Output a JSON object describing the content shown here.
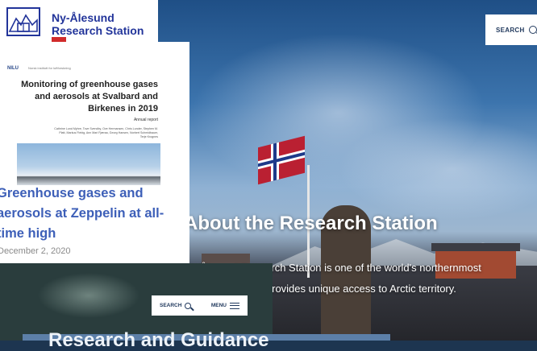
{
  "header": {
    "logo_line1": "Ny-Ålesund",
    "logo_line2": "Research Station",
    "search_label": "SEARCH",
    "search_icon": "search-icon"
  },
  "news": {
    "report_org": "NILU",
    "report_org_sub": "Norsk institutt for luftforskning",
    "report_title": "Monitoring of greenhouse gases and aerosols at Svalbard and Birkenes in 2019",
    "report_type": "Annual report",
    "report_authors": "Cathrine Lund Myhre, Tove Svendby, Ove Hermansen, Chris Lunder, Stephen M. Platt, Markus Fiebig, Ann Mari Fjæraa, Georg Hansen, Norbert Schmidbauer, Terje Krognes",
    "title": "Greenhouse gases and aerosols at Zeppelin at all-time high",
    "date": "December 2, 2020"
  },
  "hero": {
    "title": "About the Research Station",
    "description": "Ny-Ålesund Research Station is one of the world's northernmost communities and provides unique access to Arctic territory."
  },
  "overlay_nav": {
    "search_label": "SEARCH",
    "menu_label": "MENU",
    "search_icon": "search-icon",
    "menu_icon": "hamburger-menu-icon"
  },
  "bottom": {
    "heading": "Research and Guidance"
  },
  "colors": {
    "brand_blue": "#22349a",
    "link_blue": "#3d5fb8",
    "flag_red": "#ba2032"
  }
}
